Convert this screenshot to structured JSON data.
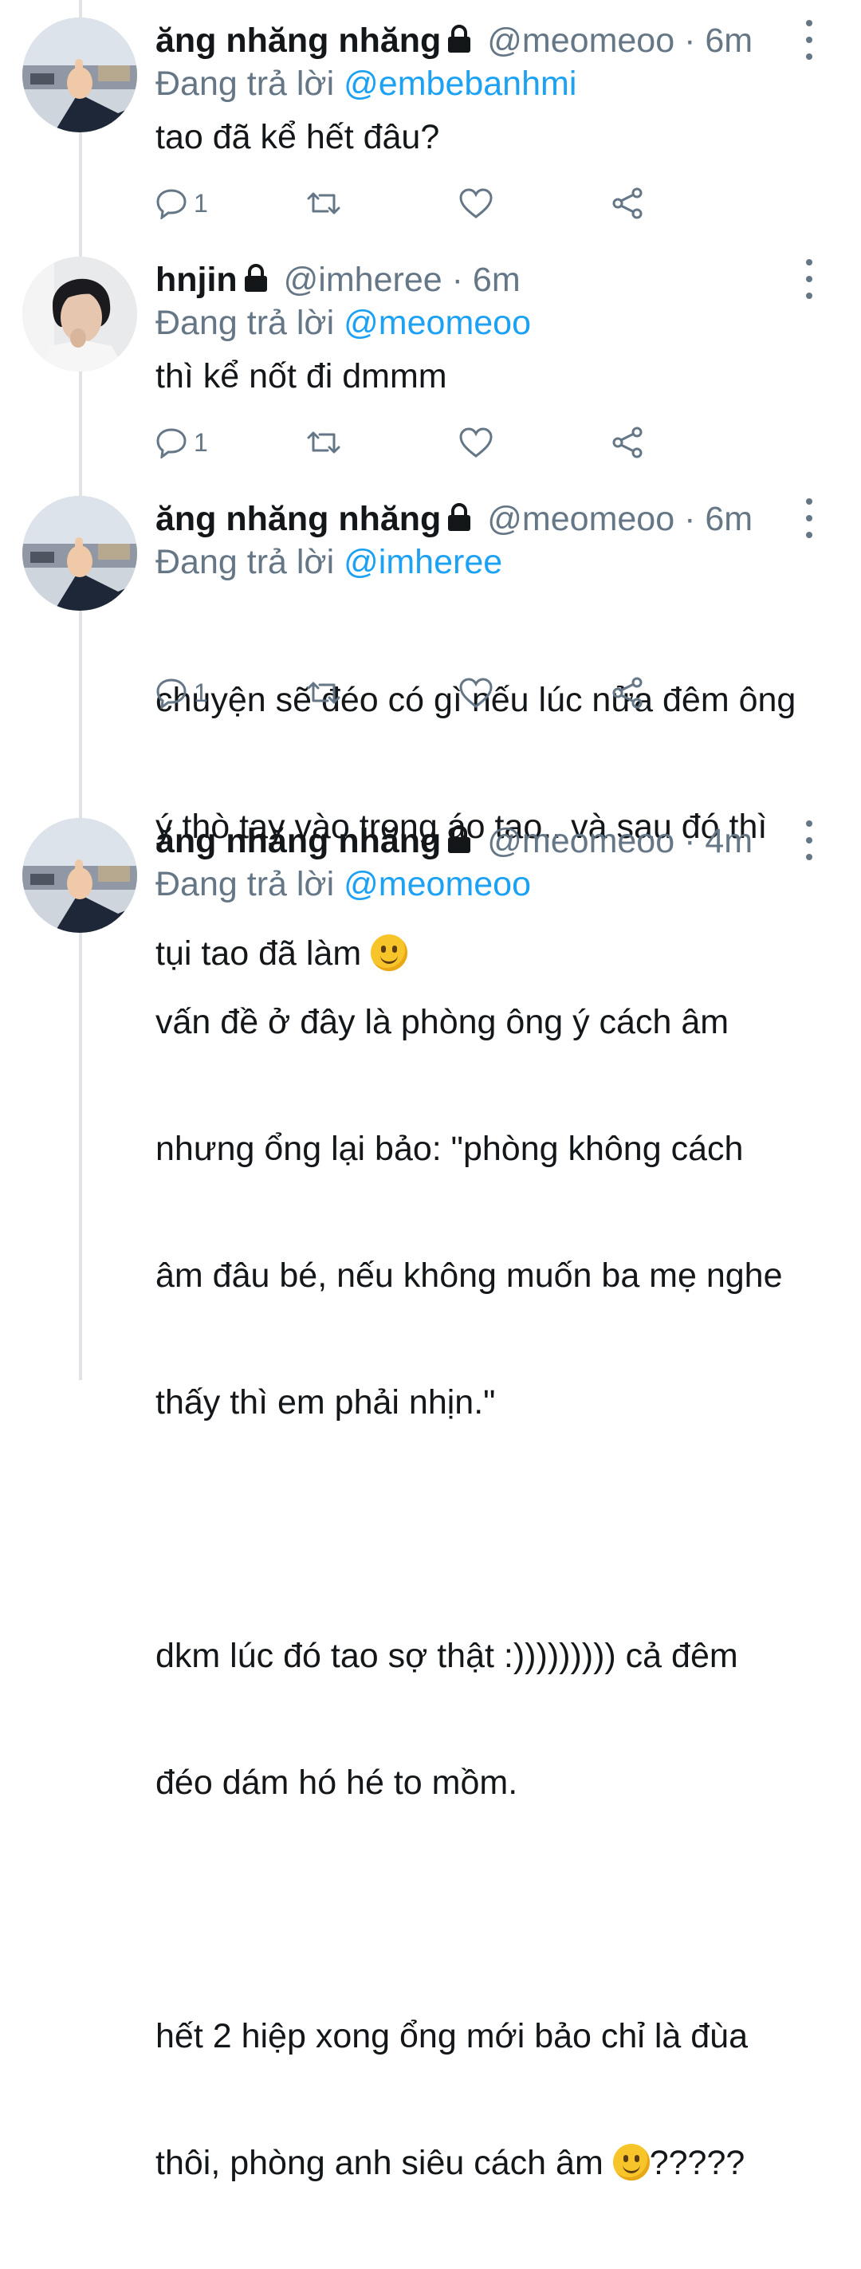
{
  "tweets": [
    {
      "name": "ăng nhăng nhăng",
      "handle": "@meomeoo",
      "dot": "·",
      "time": "6m",
      "reply_prefix": "Đang trả lời",
      "reply_to": "@embebanhmi",
      "text": "tao đã kể hết đâu?",
      "reply_count": "1",
      "avatar": "thumbs-up-avatar"
    },
    {
      "name": "hnjin",
      "handle": "@imheree",
      "dot": "·",
      "time": "6m",
      "reply_prefix": "Đang trả lời",
      "reply_to": "@meomeoo",
      "text": "thì kể nốt đi dmmm",
      "reply_count": "1",
      "avatar": "person-avatar"
    },
    {
      "name": "ăng nhăng nhăng",
      "handle": "@meomeoo",
      "dot": "·",
      "time": "6m",
      "reply_prefix": "Đang trả lời",
      "reply_to": "@imheree",
      "text_lines": [
        "chuyện sẽ đéo có gì nếu lúc nửa đêm ông",
        "ý thò tay vào trong áo tao.. và sau đó thì",
        "tụi tao đã làm "
      ],
      "reply_count": "1",
      "avatar": "thumbs-up-avatar"
    },
    {
      "name": "ăng nhăng nhăng",
      "handle": "@meomeoo",
      "dot": "·",
      "time": "4m",
      "reply_prefix": "Đang trả lời",
      "reply_to": "@meomeoo",
      "text_lines": [
        "vấn đề ở đây là phòng ông ý cách âm",
        "nhưng ổng lại bảo: \"phòng không cách",
        "âm đâu bé, nếu không muốn ba mẹ nghe",
        "thấy thì em phải nhịn.\"",
        "",
        "dkm lúc đó tao sợ thật :))))))))) cả đêm",
        "đéo dám hó hé to mồm.",
        "",
        "hết 2 hiệp xong ổng mới bảo chỉ là đùa",
        "thôi, phòng anh siêu cách âm "
      ],
      "text_tail": "?????",
      "avatar": "thumbs-up-avatar"
    }
  ],
  "colors": {
    "name": "#14171a",
    "muted": "#657786",
    "mention": "#1da1f2",
    "thread_line": "#dfe3e6"
  }
}
